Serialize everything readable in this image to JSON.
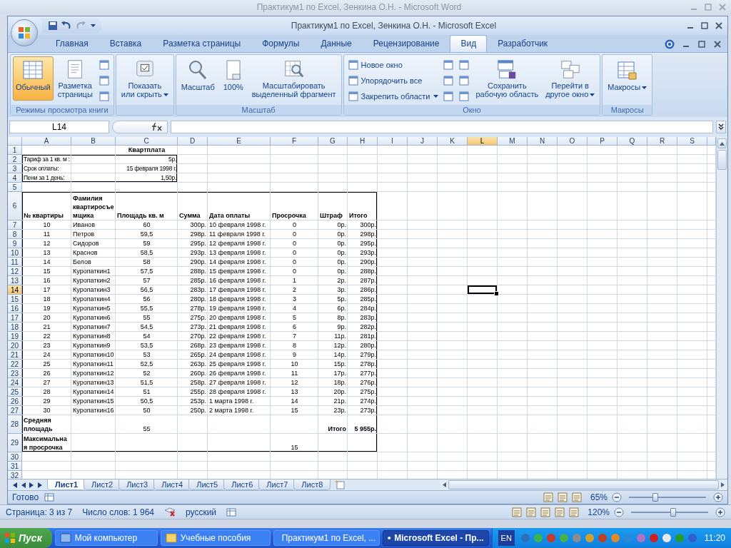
{
  "background_window": {
    "title": "Практикум1 по Excel, Зенкина О.Н. - Microsoft Word"
  },
  "window": {
    "title": "Практикум1 по Excel, Зенкина О.Н. - Microsoft Excel"
  },
  "ribbon_tabs": [
    {
      "label": "Главная",
      "selected": false
    },
    {
      "label": "Вставка",
      "selected": false
    },
    {
      "label": "Разметка страницы",
      "selected": false
    },
    {
      "label": "Формулы",
      "selected": false
    },
    {
      "label": "Данные",
      "selected": false
    },
    {
      "label": "Рецензирование",
      "selected": false
    },
    {
      "label": "Вид",
      "selected": true
    },
    {
      "label": "Разработчик",
      "selected": false
    }
  ],
  "ribbon_groups": [
    {
      "label": "Режимы просмотра книги",
      "buttons": [
        {
          "kind": "large",
          "label": "Обычный",
          "selected": true
        },
        {
          "kind": "large",
          "label": "Разметка\nстраницы",
          "selected": false
        },
        {
          "kind": "small"
        },
        {
          "kind": "small"
        },
        {
          "kind": "small"
        }
      ]
    },
    {
      "buttons": [
        {
          "kind": "large",
          "label": "Показать\nили скрыть",
          "dropdown": true
        }
      ]
    },
    {
      "label": "Масштаб",
      "buttons": [
        {
          "kind": "large",
          "label": "Масштаб"
        },
        {
          "kind": "large",
          "label": "100%"
        },
        {
          "kind": "large",
          "label": "Масштабировать\nвыделенный фрагмент"
        }
      ]
    },
    {
      "label": "Окно",
      "buttons": [
        {
          "kind": "small",
          "label": "Новое окно"
        },
        {
          "kind": "small",
          "label": "Упорядочить все"
        },
        {
          "kind": "small",
          "label": "Закрепить области",
          "dropdown": true
        },
        {
          "kind": "small"
        },
        {
          "kind": "small"
        },
        {
          "kind": "small"
        },
        {
          "kind": "small"
        },
        {
          "kind": "small"
        },
        {
          "kind": "small"
        },
        {
          "kind": "large",
          "label": "Сохранить\nрабочую область"
        },
        {
          "kind": "large",
          "label": "Перейти в\nдругое окно",
          "dropdown": true
        }
      ]
    },
    {
      "label": "Макросы",
      "buttons": [
        {
          "kind": "large",
          "label": "Макросы",
          "dropdown": true
        }
      ]
    }
  ],
  "formula_bar": {
    "name_box": "L14"
  },
  "sheet": {
    "columns": [
      {
        "label": "A",
        "selected": false
      },
      {
        "label": "B",
        "selected": false
      },
      {
        "label": "C",
        "selected": false
      },
      {
        "label": "D",
        "selected": false
      },
      {
        "label": "E",
        "selected": false
      },
      {
        "label": "F",
        "selected": false
      },
      {
        "label": "G",
        "selected": false
      },
      {
        "label": "H",
        "selected": false
      },
      {
        "label": "I",
        "selected": false
      },
      {
        "label": "J",
        "selected": false
      },
      {
        "label": "K",
        "selected": false
      },
      {
        "label": "L",
        "selected": true
      },
      {
        "label": "M",
        "selected": false
      },
      {
        "label": "N",
        "selected": false
      },
      {
        "label": "O",
        "selected": false
      },
      {
        "label": "P",
        "selected": false
      },
      {
        "label": "Q",
        "selected": false
      },
      {
        "label": "R",
        "selected": false
      },
      {
        "label": "S",
        "selected": false
      }
    ],
    "rows": [
      {
        "number": "1",
        "kind": "title",
        "selected": false,
        "cells": [
          null,
          null,
          "Квартплата"
        ]
      },
      {
        "number": "2",
        "kind": "info",
        "selected": false,
        "cells": [
          "Тариф за 1 кв. м :",
          null,
          "5р."
        ]
      },
      {
        "number": "3",
        "kind": "info",
        "selected": false,
        "cells": [
          "Срок оплаты:",
          null,
          "15 февраля 1998 г."
        ]
      },
      {
        "number": "4",
        "kind": "info",
        "selected": false,
        "cells": [
          "Пени за 1 день:",
          null,
          "1,50р."
        ]
      },
      {
        "number": "5",
        "kind": "blank",
        "selected": false
      },
      {
        "number": "6",
        "kind": "header",
        "selected": false,
        "cells": [
          "№ квартиры",
          "Фамилия квартиросъемщика",
          "Площадь кв. м",
          "Сумма",
          "Дата оплаты",
          "Просрочка",
          "Штраф",
          "Итого"
        ]
      },
      {
        "number": "7",
        "kind": "data",
        "selected": false,
        "cells": [
          "10",
          "Иванов",
          "60",
          "300р.",
          "10 февраля 1998 г.",
          "0",
          "0р.",
          "300р."
        ]
      },
      {
        "number": "8",
        "kind": "data",
        "selected": false,
        "cells": [
          "11",
          "Петров",
          "59,5",
          "298р.",
          "11 февраля 1998 г.",
          "0",
          "0р.",
          "298р."
        ]
      },
      {
        "number": "9",
        "kind": "data",
        "selected": false,
        "cells": [
          "12",
          "Сидоров",
          "59",
          "295р.",
          "12 февраля 1998 г.",
          "0",
          "0р.",
          "295р."
        ]
      },
      {
        "number": "10",
        "kind": "data",
        "selected": false,
        "cells": [
          "13",
          "Краснов",
          "58,5",
          "293р.",
          "13 февраля 1998 г.",
          "0",
          "0р.",
          "293р."
        ]
      },
      {
        "number": "11",
        "kind": "data",
        "selected": false,
        "cells": [
          "14",
          "Белов",
          "58",
          "290р.",
          "14 февраля 1998 г.",
          "0",
          "0р.",
          "290р."
        ]
      },
      {
        "number": "12",
        "kind": "data",
        "selected": false,
        "cells": [
          "15",
          "Куропаткин1",
          "57,5",
          "288р.",
          "15 февраля 1998 г.",
          "0",
          "0р.",
          "288р."
        ]
      },
      {
        "number": "13",
        "kind": "data",
        "selected": false,
        "cells": [
          "16",
          "Куропаткин2",
          "57",
          "285р.",
          "16 февраля 1998 г.",
          "1",
          "2р.",
          "287р."
        ]
      },
      {
        "number": "14",
        "kind": "data",
        "selected": true,
        "cells": [
          "17",
          "Куропаткин3",
          "56,5",
          "283р.",
          "17 февраля 1998 г.",
          "2",
          "3р.",
          "286р."
        ]
      },
      {
        "number": "15",
        "kind": "data",
        "selected": false,
        "cells": [
          "18",
          "Куропаткин4",
          "56",
          "280р.",
          "18 февраля 1998 г.",
          "3",
          "5р.",
          "285р."
        ]
      },
      {
        "number": "16",
        "kind": "data",
        "selected": false,
        "cells": [
          "19",
          "Куропаткин5",
          "55,5",
          "278р.",
          "19 февраля 1998 г.",
          "4",
          "6р.",
          "284р."
        ]
      },
      {
        "number": "17",
        "kind": "data",
        "selected": false,
        "cells": [
          "20",
          "Куропаткин6",
          "55",
          "275р.",
          "20 февраля 1998 г.",
          "5",
          "8р.",
          "283р."
        ]
      },
      {
        "number": "18",
        "kind": "data",
        "selected": false,
        "cells": [
          "21",
          "Куропаткин7",
          "54,5",
          "273р.",
          "21 февраля 1998 г.",
          "6",
          "9р.",
          "282р."
        ]
      },
      {
        "number": "19",
        "kind": "data",
        "selected": false,
        "cells": [
          "22",
          "Куропаткин8",
          "54",
          "270р.",
          "22 февраля 1998 г.",
          "7",
          "11р.",
          "281р."
        ]
      },
      {
        "number": "20",
        "kind": "data",
        "selected": false,
        "cells": [
          "23",
          "Куропаткин9",
          "53,5",
          "268р.",
          "23 февраля 1998 г.",
          "8",
          "12р.",
          "280р."
        ]
      },
      {
        "number": "21",
        "kind": "data",
        "selected": false,
        "cells": [
          "24",
          "Куропаткин10",
          "53",
          "265р.",
          "24 февраля 1998 г.",
          "9",
          "14р.",
          "279р."
        ]
      },
      {
        "number": "22",
        "kind": "data",
        "selected": false,
        "cells": [
          "25",
          "Куропаткин11",
          "52,5",
          "263р.",
          "25 февраля 1998 г.",
          "10",
          "15р.",
          "278р."
        ]
      },
      {
        "number": "23",
        "kind": "data",
        "selected": false,
        "cells": [
          "26",
          "Куропаткин12",
          "52",
          "260р.",
          "26 февраля 1998 г.",
          "11",
          "17р.",
          "277р."
        ]
      },
      {
        "number": "24",
        "kind": "data",
        "selected": false,
        "cells": [
          "27",
          "Куропаткин13",
          "51,5",
          "258р.",
          "27 февраля 1998 г.",
          "12",
          "18р.",
          "276р."
        ]
      },
      {
        "number": "25",
        "kind": "data",
        "selected": false,
        "cells": [
          "28",
          "Куропаткин14",
          "51",
          "255р.",
          "28 февраля 1998 г.",
          "13",
          "20р.",
          "275р."
        ]
      },
      {
        "number": "26",
        "kind": "data",
        "selected": false,
        "cells": [
          "29",
          "Куропаткин15",
          "50,5",
          "253р.",
          "1 марта 1998 г.",
          "14",
          "21р.",
          "274р."
        ]
      },
      {
        "number": "27",
        "kind": "data",
        "selected": false,
        "cells": [
          "30",
          "Куропаткин16",
          "50",
          "250р.",
          "2 марта 1998 г.",
          "15",
          "23р.",
          "273р."
        ]
      },
      {
        "number": "28",
        "kind": "summary",
        "selected": false,
        "cells": [
          "Средняя площадь",
          null,
          "55",
          null,
          null,
          null,
          "Итого",
          "5 955р."
        ]
      },
      {
        "number": "29",
        "kind": "summary",
        "selected": false,
        "cells": [
          "Максимальная просрочка",
          null,
          null,
          null,
          null,
          "15"
        ]
      },
      {
        "number": "30",
        "kind": "blank",
        "selected": false
      },
      {
        "number": "31",
        "kind": "blank",
        "selected": false
      },
      {
        "number": "32",
        "kind": "blank",
        "selected": false
      }
    ]
  },
  "sheet_tabs": [
    {
      "label": "Лист1",
      "selected": true
    },
    {
      "label": "Лист2",
      "selected": false
    },
    {
      "label": "Лист3",
      "selected": false
    },
    {
      "label": "Лист4",
      "selected": false
    },
    {
      "label": "Лист5",
      "selected": false
    },
    {
      "label": "Лист6",
      "selected": false
    },
    {
      "label": "Лист7",
      "selected": false
    },
    {
      "label": "Лист8",
      "selected": false
    }
  ],
  "status_bar": {
    "text": "Готово",
    "zoom": "65%",
    "zoom_slider": {
      "level": 0.33
    }
  },
  "word_status_bar": {
    "page": "Страница: 3 из 7",
    "words": "Число слов: 1 964",
    "language": "русский",
    "zoom": "120%",
    "zoom_slider": {
      "level": 0.55
    }
  },
  "taskbar": {
    "start": "Пуск",
    "items": [
      {
        "label": "Мой компьютер",
        "selected": false
      },
      {
        "label": "Учебные пособия",
        "selected": false
      },
      {
        "label": "Практикум1 по Excel, ...",
        "selected": false
      },
      {
        "label": "Microsoft Excel - Пр...",
        "selected": true
      }
    ],
    "language": "EN",
    "clock": "11:20"
  }
}
